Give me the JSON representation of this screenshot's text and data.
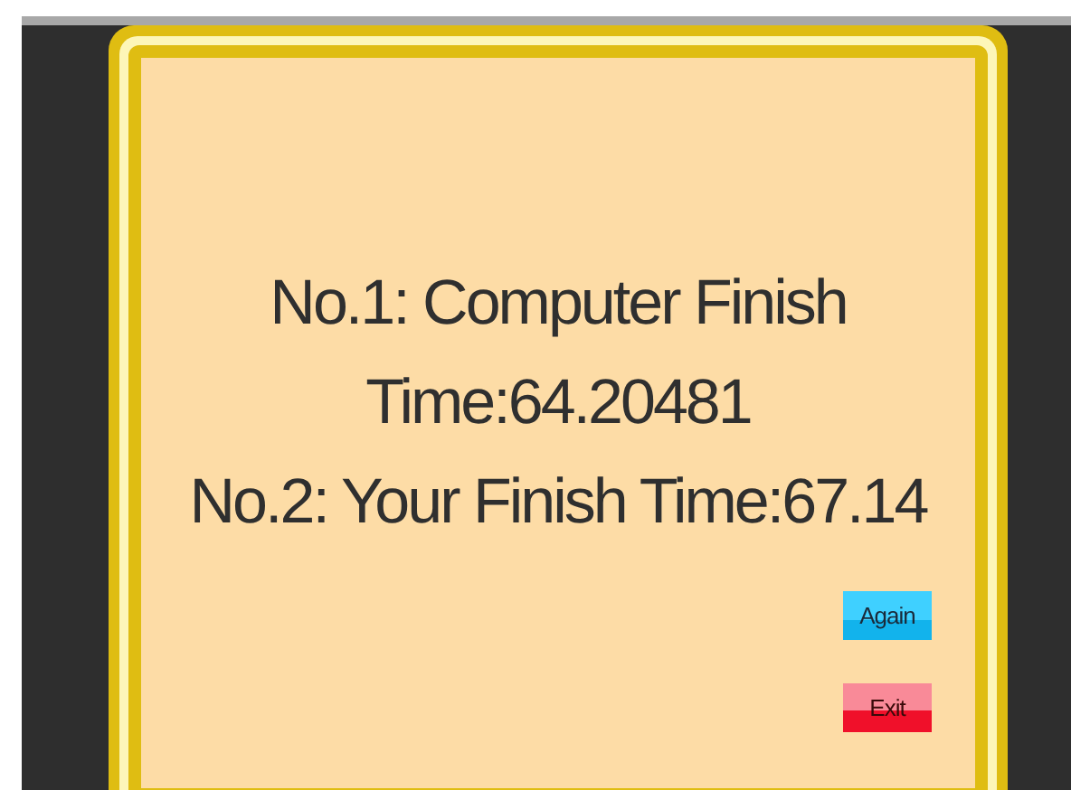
{
  "result_lines": [
    "No.1: Computer Finish",
    "Time:64.20481",
    "No.2: Your Finish Time:67.14"
  ],
  "buttons": [
    {
      "label": "Again",
      "kind": "again"
    },
    {
      "label": "Exit",
      "kind": "exit"
    }
  ]
}
